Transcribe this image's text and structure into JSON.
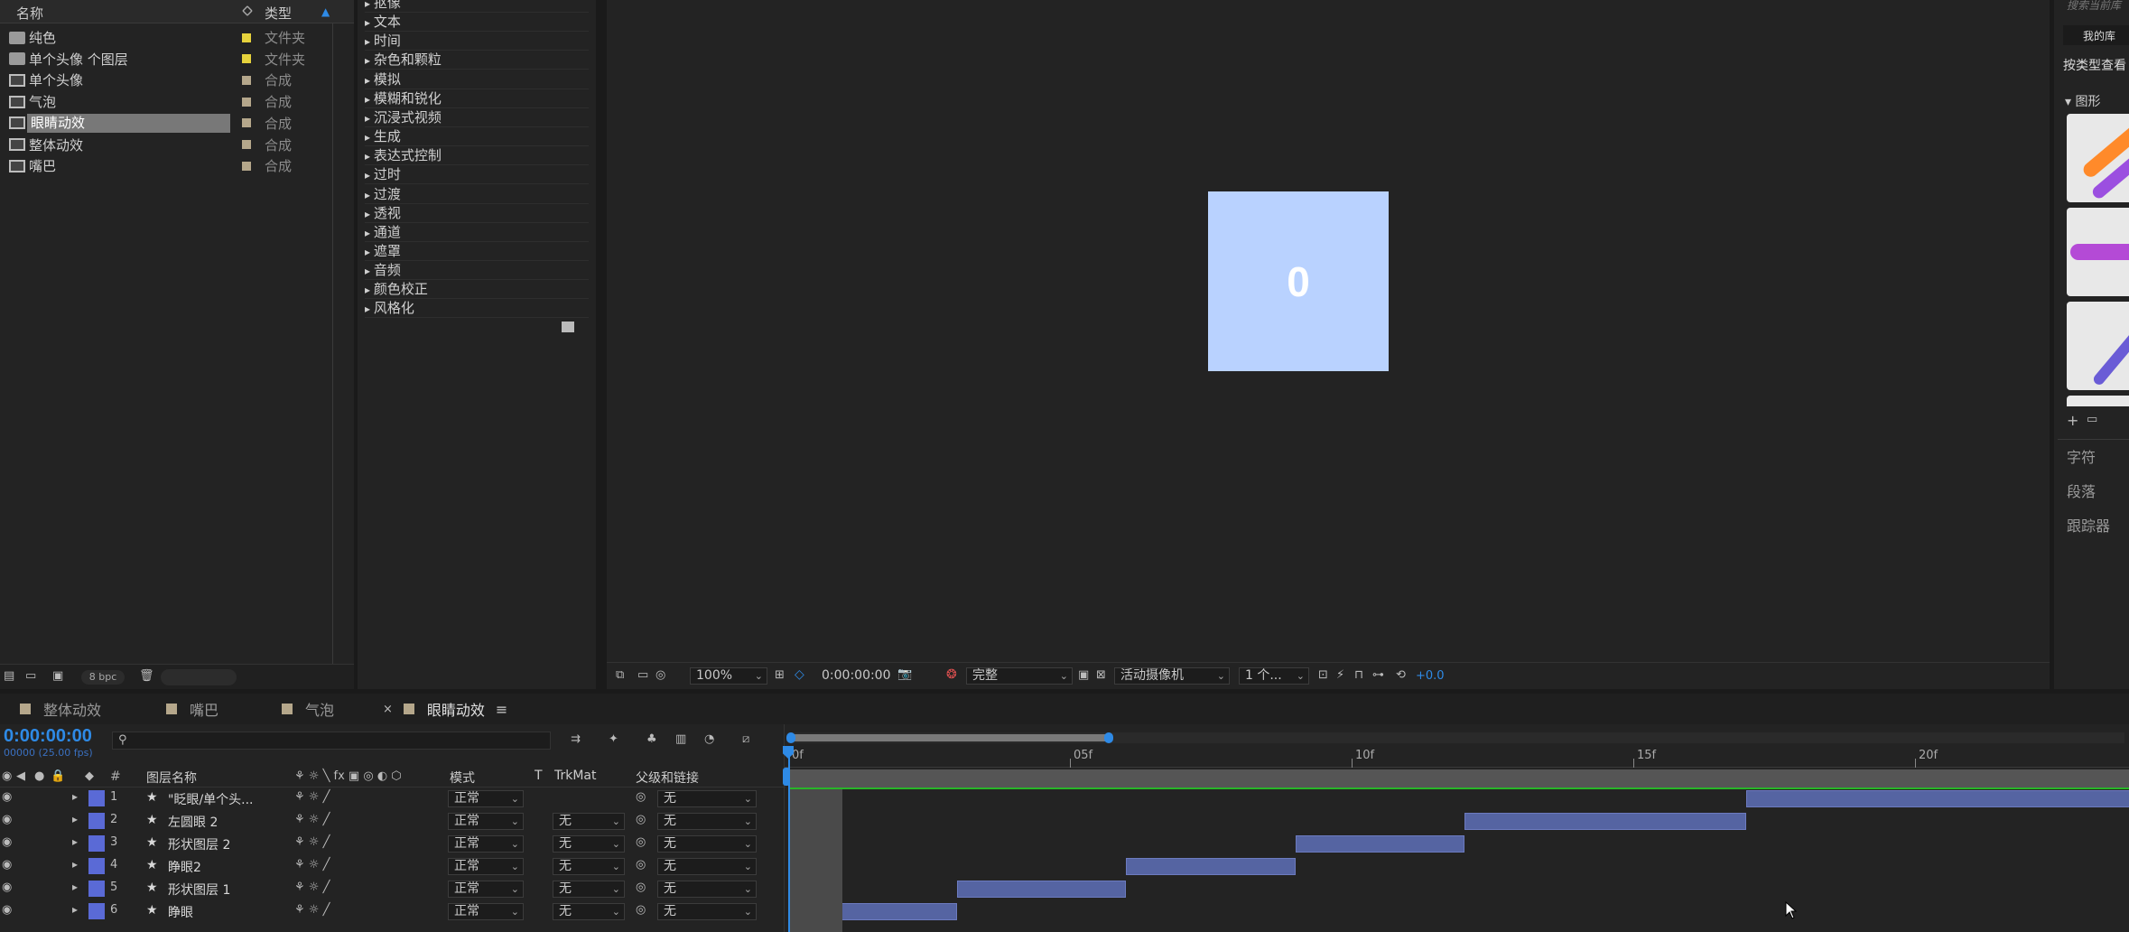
{
  "project": {
    "col_name": "名称",
    "col_type": "类型",
    "items": [
      {
        "name": "纯色",
        "type": "文件夹",
        "kind": "folder",
        "label_color": "#e6d23c"
      },
      {
        "name": "单个头像 个图层",
        "type": "文件夹",
        "kind": "folder",
        "label_color": "#e6d23c"
      },
      {
        "name": "单个头像",
        "type": "合成",
        "kind": "comp",
        "label_color": "#b5a78b"
      },
      {
        "name": "气泡",
        "type": "合成",
        "kind": "comp",
        "label_color": "#b5a78b"
      },
      {
        "name": "眼睛动效",
        "type": "合成",
        "kind": "comp",
        "label_color": "#b5a78b",
        "selected": true
      },
      {
        "name": "整体动效",
        "type": "合成",
        "kind": "comp",
        "label_color": "#b5a78b"
      },
      {
        "name": "嘴巴",
        "type": "合成",
        "kind": "comp",
        "label_color": "#b5a78b"
      }
    ],
    "bpc": "8 bpc"
  },
  "effects": {
    "items": [
      "抠像",
      "文本",
      "时间",
      "杂色和颗粒",
      "模拟",
      "模糊和锐化",
      "沉浸式视频",
      "生成",
      "表达式控制",
      "过时",
      "过渡",
      "透视",
      "通道",
      "遮罩",
      "音频",
      "颜色校正",
      "风格化"
    ]
  },
  "viewer": {
    "canvas_text": "0",
    "canvas_color": "#b9d2ff",
    "zoom": "100%",
    "timecode": "0:00:00:00",
    "resolution": "完整",
    "camera": "活动摄像机",
    "views": "1 个...",
    "exposure": "+0.0"
  },
  "library": {
    "search_placeholder": "搜索当前库",
    "my_library": "我的库",
    "view_by_type": "按类型查看",
    "section": "图形",
    "panels": [
      "字符",
      "段落",
      "跟踪器"
    ]
  },
  "timeline": {
    "tabs": [
      "整体动效",
      "嘴巴",
      "气泡",
      "眼睛动效"
    ],
    "active_tab": "眼睛动效",
    "timecode": "0:00:00:00",
    "fps": "00000 (25.00 fps)",
    "headers": {
      "num": "#",
      "layer_name": "图层名称",
      "mode": "模式",
      "t": "T",
      "trkmat": "TrkMat",
      "parent": "父级和链接"
    },
    "ruler": [
      "0f",
      "05f",
      "10f",
      "15f",
      "20f"
    ],
    "layers": [
      {
        "num": "1",
        "name": "\"眨眼/单个头...",
        "mode": "正常",
        "trkmat": "",
        "parent": "无",
        "bar_start": 17,
        "bar_end": 25
      },
      {
        "num": "2",
        "name": "左圆眼 2",
        "mode": "正常",
        "trkmat": "无",
        "parent": "无",
        "bar_start": 12,
        "bar_end": 17
      },
      {
        "num": "3",
        "name": "形状图层 2",
        "mode": "正常",
        "trkmat": "无",
        "parent": "无",
        "bar_start": 9,
        "bar_end": 12
      },
      {
        "num": "4",
        "name": "睁眼2",
        "mode": "正常",
        "trkmat": "无",
        "parent": "无",
        "bar_start": 6,
        "bar_end": 9
      },
      {
        "num": "5",
        "name": "形状图层 1",
        "mode": "正常",
        "trkmat": "无",
        "parent": "无",
        "bar_start": 3,
        "bar_end": 6
      },
      {
        "num": "6",
        "name": "睁眼",
        "mode": "正常",
        "trkmat": "无",
        "parent": "无",
        "bar_start": 0,
        "bar_end": 3
      }
    ]
  }
}
